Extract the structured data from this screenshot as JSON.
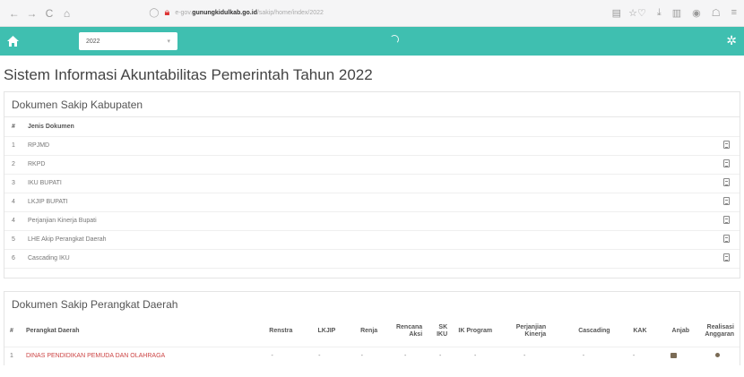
{
  "browser": {
    "back": "←",
    "forward": "→",
    "reload": "C",
    "home": "⌂",
    "url_prefix": "e-gov.",
    "url_host": "gunungkidulkab.go.id",
    "url_path": "/sakip/home/index/2022",
    "icons": [
      "bookmark-icon",
      "star-icon",
      "shield-icon",
      "download-icon",
      "library-icon",
      "account-icon",
      "extensions-icon"
    ]
  },
  "appbar": {
    "year_value": "2022",
    "year_caret": "▾",
    "accent": "#3fbfb0"
  },
  "page": {
    "title": "Sistem Informasi Akuntabilitas Pemerintah Tahun 2022"
  },
  "kabupaten": {
    "header": "Dokumen Sakip Kabupaten",
    "columns": [
      "#",
      "Jenis Dokumen"
    ],
    "rows": [
      {
        "no": "1",
        "name": "RPJMD"
      },
      {
        "no": "2",
        "name": "RKPD"
      },
      {
        "no": "3",
        "name": "IKU BUPATI"
      },
      {
        "no": "4",
        "name": "LKJIP BUPATI"
      },
      {
        "no": "4",
        "name": "Perjanjian Kinerja Bupati"
      },
      {
        "no": "5",
        "name": "LHE Akip Perangkat Daerah"
      },
      {
        "no": "6",
        "name": "Cascading IKU"
      }
    ]
  },
  "perangkat": {
    "header": "Dokumen Sakip Perangkat Daerah",
    "columns": [
      "#",
      "Perangkat Daerah",
      "Renstra",
      "LKJIP",
      "Renja",
      "Rencana Aksi",
      "SK IKU",
      "IK Program",
      "Perjanjian Kinerja",
      "Cascading",
      "KAK",
      "Anjab",
      "Realisasi Anggaran"
    ],
    "rows": [
      {
        "no": "1",
        "name": "DINAS PENDIDIKAN PEMUDA DAN OLAHRAGA",
        "cells": [
          "-",
          "-",
          "-",
          "-",
          "-",
          "-",
          "-",
          "-",
          "-"
        ]
      }
    ]
  }
}
